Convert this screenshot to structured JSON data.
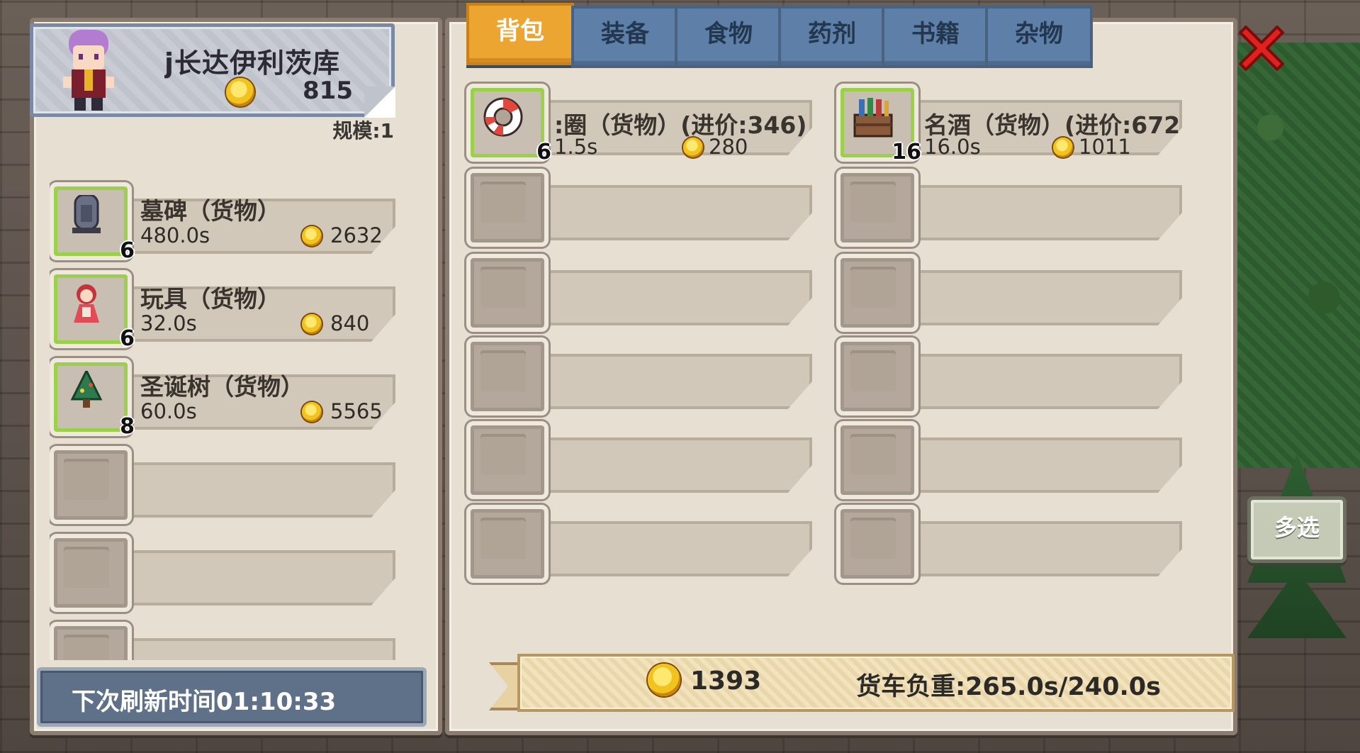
{
  "merchant": {
    "name": "行长达伊利茨库",
    "name_shown": "j长达伊利茨库",
    "gold": "815",
    "scale": "规模:1"
  },
  "shop_items": [
    {
      "name": "墓碑（货物）",
      "qty": "6",
      "time": "480.0s",
      "price": "2632",
      "icon": "tombstone-icon"
    },
    {
      "name": "玩具（货物）",
      "qty": "6",
      "time": "32.0s",
      "price": "840",
      "icon": "doll-toy-icon"
    },
    {
      "name": "圣诞树（货物）",
      "qty": "8",
      "time": "60.0s",
      "price": "5565",
      "icon": "christmas-tree-icon"
    }
  ],
  "refresh": "下次刷新时间01:10:33",
  "tabs": [
    {
      "label": "背包",
      "active": true
    },
    {
      "label": "装备",
      "active": false
    },
    {
      "label": "食物",
      "active": false
    },
    {
      "label": "药剂",
      "active": false
    },
    {
      "label": "书籍",
      "active": false
    },
    {
      "label": "杂物",
      "active": false
    }
  ],
  "inventory": [
    {
      "name": ":圈（货物）(进价:346)",
      "qty": "6",
      "time": "1.5s",
      "price": "280",
      "icon": "life-ring-icon"
    },
    {
      "name": "名酒（货物）(进价:672",
      "qty": "16",
      "time": "16.0s",
      "price": "1011",
      "icon": "wine-crate-icon"
    }
  ],
  "multi_select": "多选",
  "footer": {
    "money": "1393",
    "load": "货车负重:265.0s/240.0s"
  },
  "colors": {
    "tab_active": "#eda532",
    "tab_inactive": "#5e7fa8",
    "panel": "#e6dfd2",
    "slot_highlight": "#9bd04a",
    "close_red": "#e0221e"
  }
}
